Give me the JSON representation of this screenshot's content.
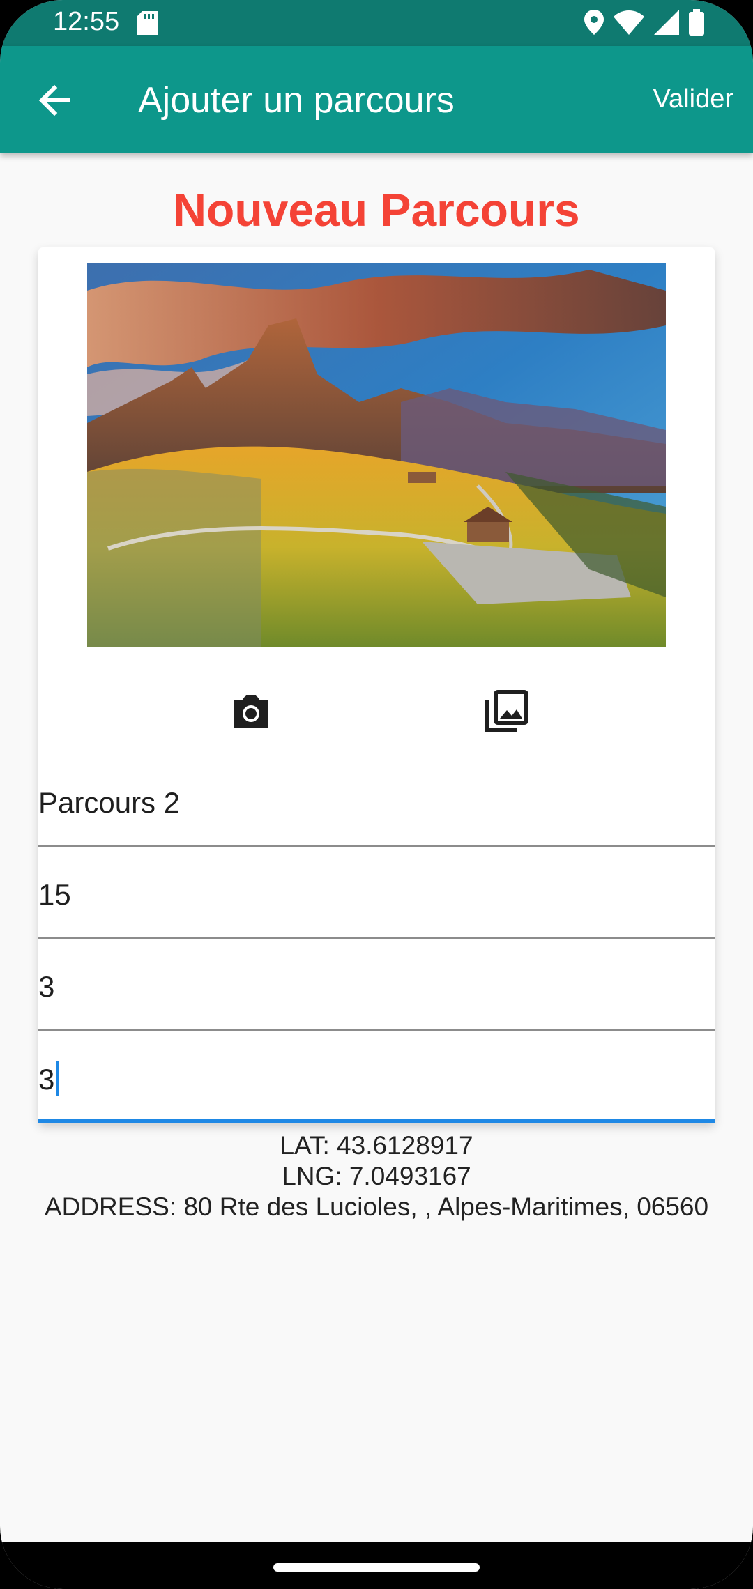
{
  "status_bar": {
    "time": "12:55",
    "icons": [
      "sd-card-icon",
      "location-icon",
      "wifi-icon",
      "signal-icon",
      "battery-icon"
    ]
  },
  "app_bar": {
    "title": "Ajouter un parcours",
    "back_icon": "arrow-back-icon",
    "validate_label": "Valider",
    "color": "#0d978b"
  },
  "page": {
    "heading": "Nouveau Parcours",
    "heading_color": "#f44336"
  },
  "card": {
    "photo_icon_actions": [
      "camera-icon",
      "photo-library-icon"
    ],
    "fields": [
      {
        "value": "Parcours 2"
      },
      {
        "value": "15"
      },
      {
        "value": "3"
      },
      {
        "value": "3",
        "focused": true
      }
    ]
  },
  "location": {
    "lat": "LAT: 43.6128917",
    "lng": "LNG: 7.0493167",
    "address": "ADDRESS: 80 Rte des Lucioles, , Alpes-Maritimes, 06560"
  }
}
